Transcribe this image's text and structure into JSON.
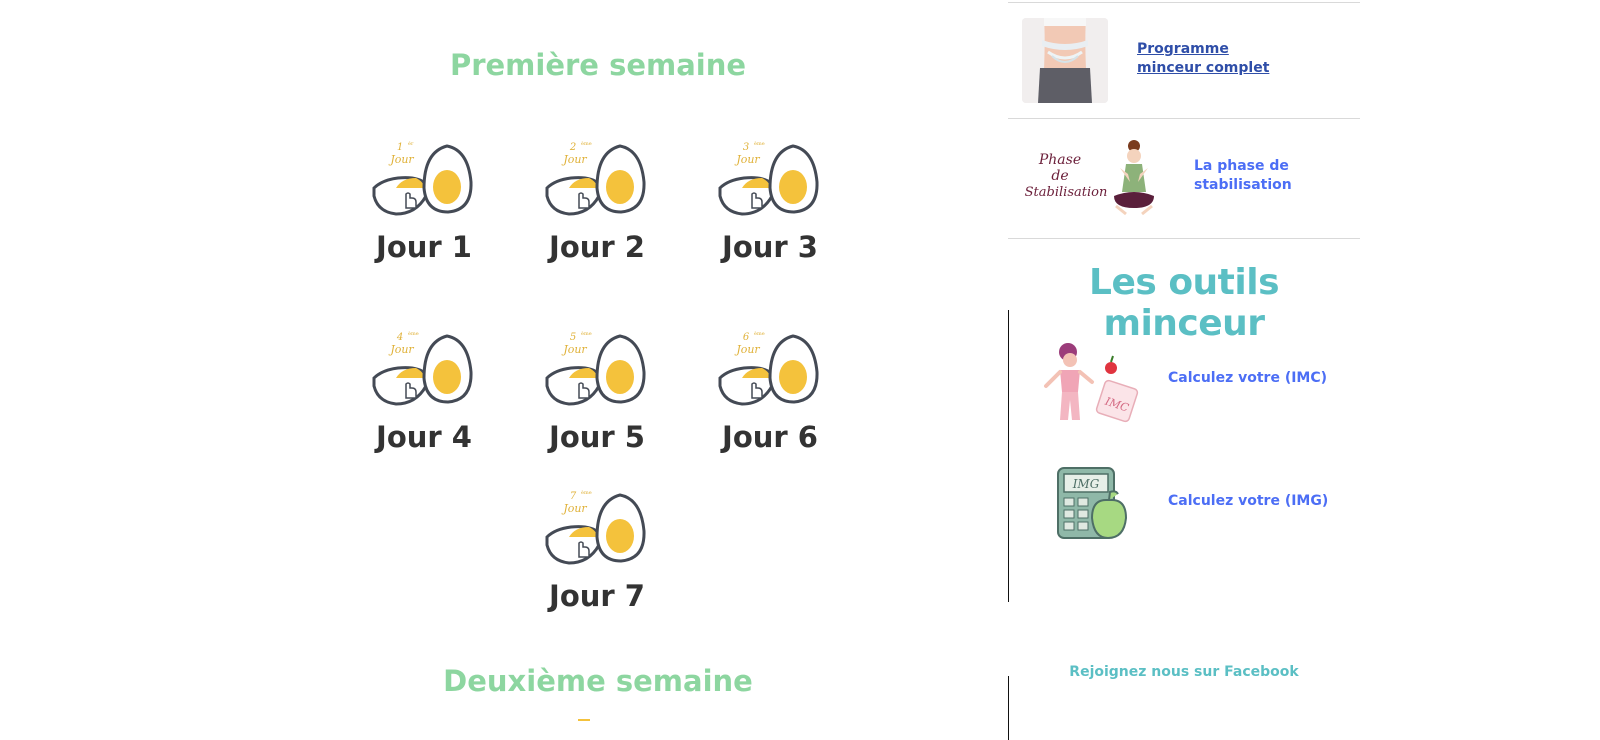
{
  "main": {
    "week1_title": "Première semaine",
    "week2_title": "Deuxième semaine",
    "days": [
      {
        "label": "Jour 1",
        "badge_num": "1",
        "badge_sup": "ér",
        "badge_word": "Jour"
      },
      {
        "label": "Jour 2",
        "badge_num": "2",
        "badge_sup": "ème",
        "badge_word": "Jour"
      },
      {
        "label": "Jour 3",
        "badge_num": "3",
        "badge_sup": "ème",
        "badge_word": "Jour"
      },
      {
        "label": "Jour 4",
        "badge_num": "4",
        "badge_sup": "ème",
        "badge_word": "Jour"
      },
      {
        "label": "Jour 5",
        "badge_num": "5",
        "badge_sup": "ème",
        "badge_word": "Jour"
      },
      {
        "label": "Jour 6",
        "badge_num": "6",
        "badge_sup": "ème",
        "badge_word": "Jour"
      },
      {
        "label": "Jour 7",
        "badge_num": "7",
        "badge_sup": "ème",
        "badge_word": "Jour"
      }
    ]
  },
  "sidebar": {
    "program_link": "Programme minceur complet",
    "stabilisation_link": "La phase de stabilisation",
    "stabilisation_image_text": "Phase de Stabilisation",
    "tools_title": "Les outils minceur",
    "imc_link": "Calculez votre (IMC)",
    "imc_image_text": "IMC",
    "img_link": "Calculez votre (IMG)",
    "img_image_text": "IMG",
    "facebook_link": "Rejoignez nous sur Facebook"
  },
  "colors": {
    "week_title": "#8dd6a0",
    "link": "#4c6ef5",
    "tools_title": "#5bbfc4",
    "egg_yolk": "#f4c23c",
    "egg_outline": "#444a55"
  }
}
